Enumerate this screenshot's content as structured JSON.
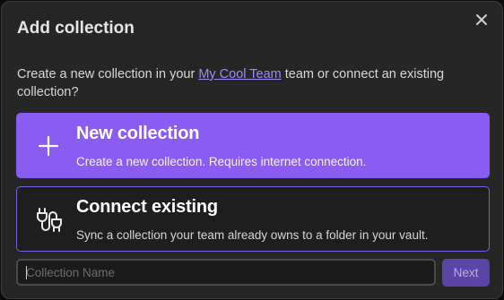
{
  "dialog": {
    "title": "Add collection",
    "description_before": "Create a new collection in your ",
    "team_link": "My Cool Team",
    "description_after": " team or connect an existing collection?"
  },
  "options": [
    {
      "icon": "plus-icon",
      "title": "New collection",
      "subtitle": "Create a new collection. Requires internet connection."
    },
    {
      "icon": "plug-connect-icon",
      "title": "Connect existing",
      "subtitle": "Sync a collection your team already owns to a folder in your vault."
    }
  ],
  "form": {
    "name_placeholder": "Collection Name",
    "name_value": "",
    "next_label": "Next"
  },
  "colors": {
    "accent": "#8a5cf2",
    "link": "#9b8cf7",
    "background": "#262626",
    "next_button": "#5b44a8"
  }
}
